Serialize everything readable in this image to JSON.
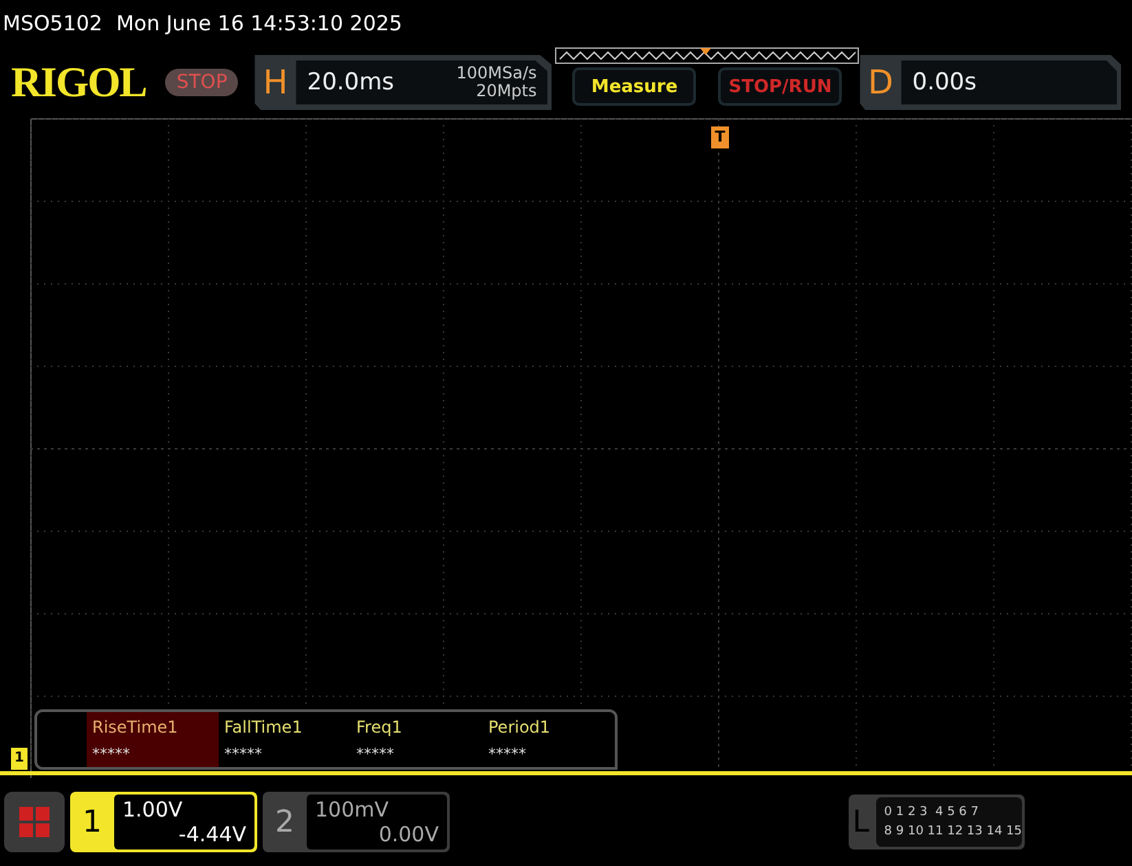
{
  "status_bar": {
    "model": "MSO5102",
    "datetime": "Mon June 16 14:53:10 2025"
  },
  "header": {
    "logo": "RIGOL",
    "run_state": {
      "label": "STOP",
      "kind": "stop"
    },
    "horizontal": {
      "letter": "H",
      "timebase": "20.0ms",
      "sample_rate": "100MSa/s",
      "memory_depth": "20Mpts"
    },
    "buttons": [
      {
        "label": "Measure",
        "kind": "menu"
      },
      {
        "label": "STOP/RUN",
        "kind": "run"
      }
    ],
    "delay": {
      "letter": "D",
      "value": "0.00s"
    }
  },
  "plot": {
    "trigger_marker": "T",
    "channel_marker": "1"
  },
  "measurements": [
    {
      "name": "RiseTime1",
      "value": "*****",
      "selected": true
    },
    {
      "name": "FallTime1",
      "value": "*****",
      "selected": false
    },
    {
      "name": "Freq1",
      "value": "*****",
      "selected": false
    },
    {
      "name": "Period1",
      "value": "*****",
      "selected": false
    }
  ],
  "channels": [
    {
      "number": "1",
      "scale": "1.00V",
      "offset": "-4.44V",
      "active": true
    },
    {
      "number": "2",
      "scale": "100mV",
      "offset": "0.00V",
      "active": false
    }
  ],
  "logic": {
    "letter": "L",
    "rows": [
      "0 1 2 3  4 5 6 7",
      "8 9 10 11 12 13 14 15"
    ]
  }
}
